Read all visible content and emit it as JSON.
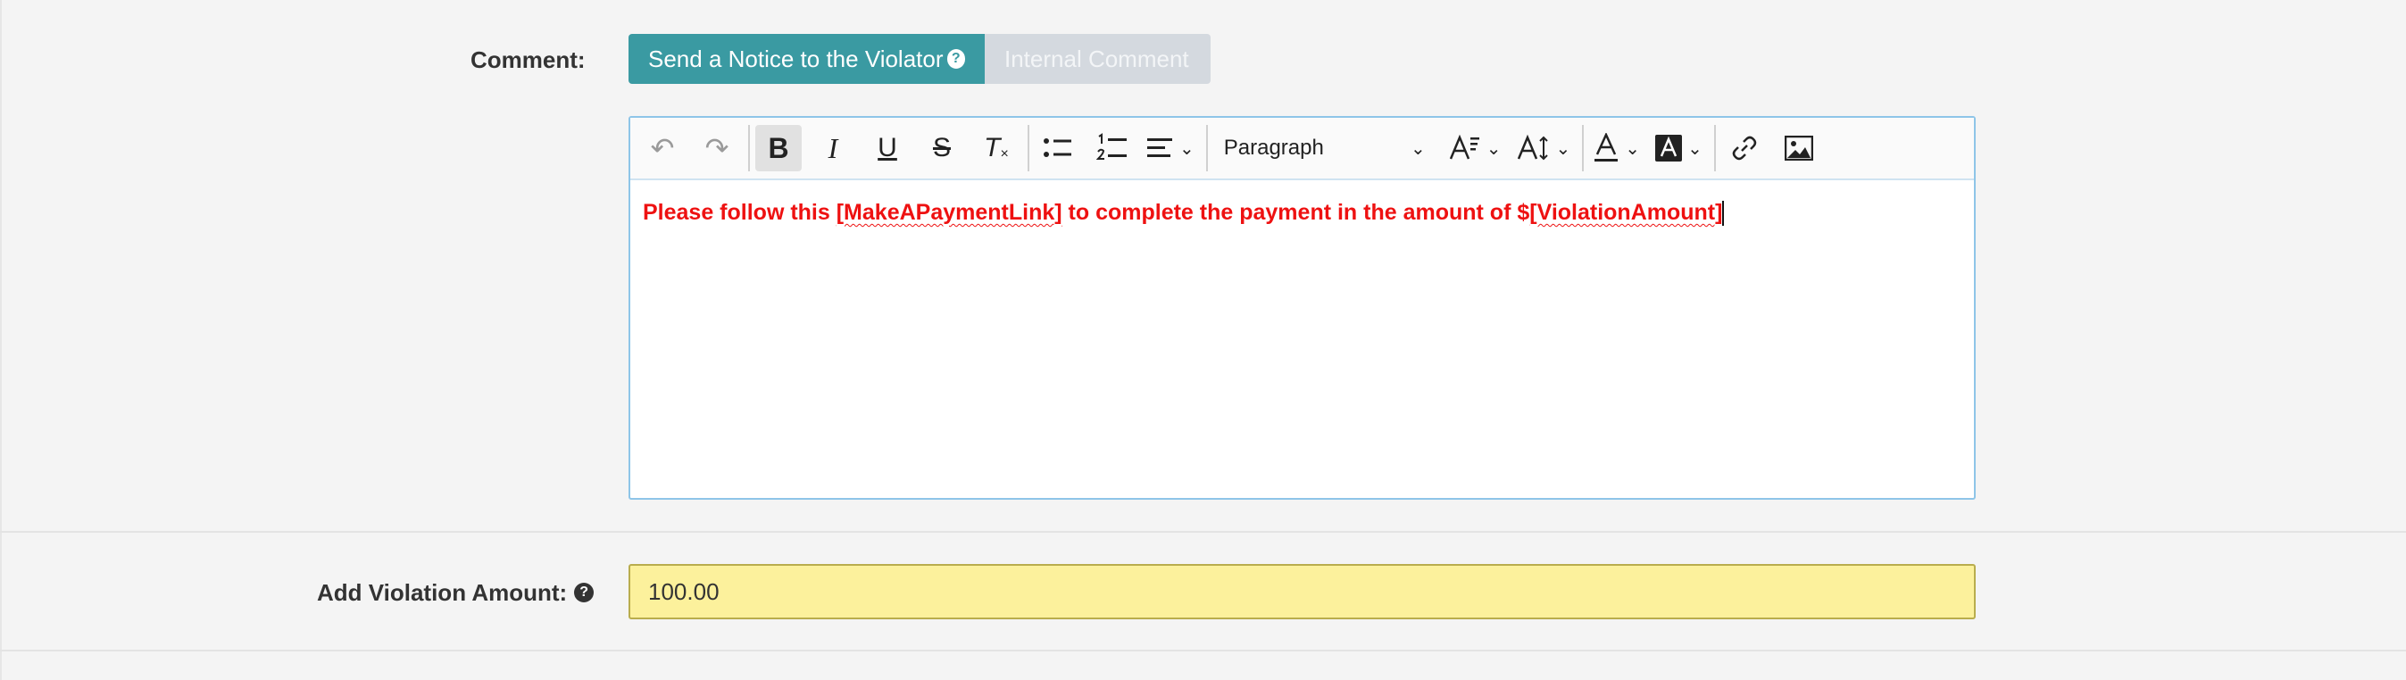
{
  "comment": {
    "label": "Comment:",
    "tabs": {
      "active_label": "Send a Notice to the Violator",
      "inactive_label": "Internal Comment"
    }
  },
  "toolbar": {
    "undo_icon": "↶",
    "redo_icon": "↷",
    "bold_icon": "B",
    "italic_icon": "I",
    "underline_icon": "U",
    "strike_icon": "S",
    "clear_format_icon": "T",
    "paragraph_label": "Paragraph"
  },
  "editor": {
    "text_before": "Please follow this ",
    "link_token": "[MakeAPaymentLink]",
    "text_middle": " to complete the payment in the amount of $",
    "amount_token": "[ViolationAmount]",
    "text_color": "#ee1111"
  },
  "amount": {
    "label": "Add Violation Amount:",
    "value": "100.00"
  },
  "colors": {
    "accent": "#3a9aa2",
    "highlight_field": "#fcf19c"
  }
}
